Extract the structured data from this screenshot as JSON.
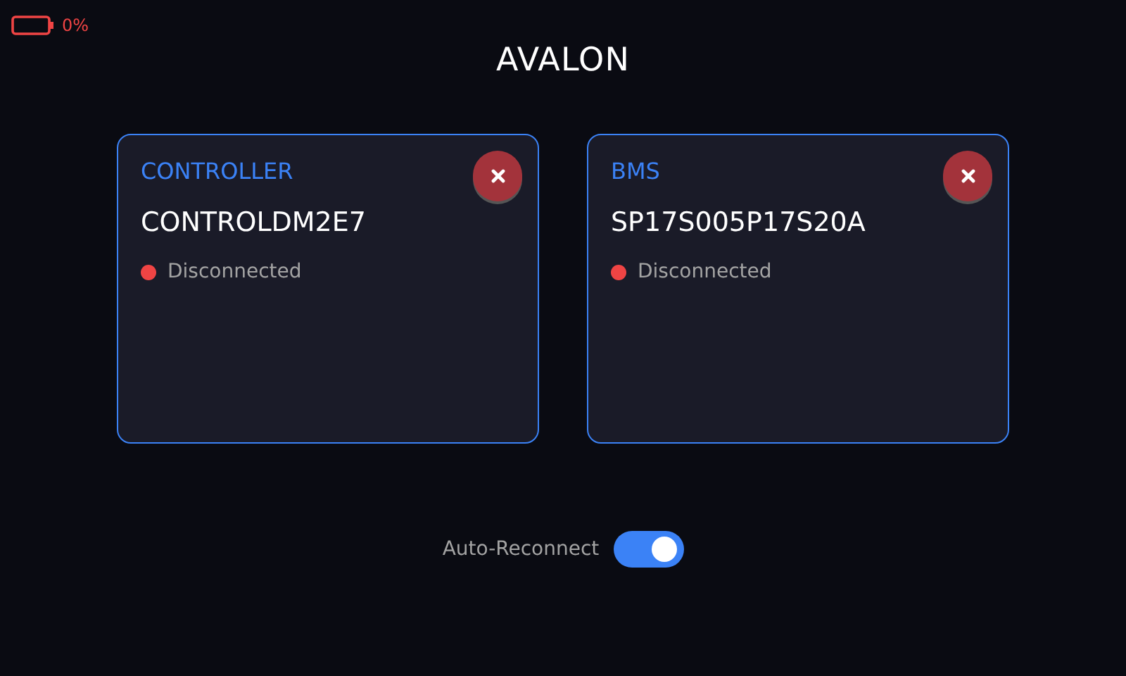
{
  "battery": {
    "reading": "0%"
  },
  "title": "AVALON",
  "devices": [
    {
      "label": "CONTROLLER",
      "name": "CONTROLDM2E7",
      "status": "Disconnected",
      "color": "#ef4444"
    },
    {
      "label": "BMS",
      "name": "SP17S005P17S20A",
      "status": "Disconnected",
      "color": "#ef4444"
    }
  ],
  "auto_reconnect": {
    "label": "Auto-Reconnect",
    "on": true
  }
}
